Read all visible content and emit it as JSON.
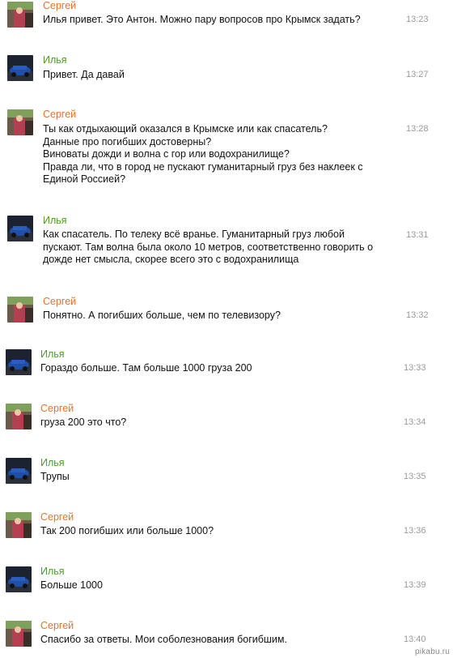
{
  "senders": {
    "sergey": "Сергей",
    "ilya": "Илья"
  },
  "colors": {
    "sergey_name": "#e8722e",
    "ilya_name": "#49a020",
    "timestamp": "#9a9a9a"
  },
  "messages": [
    {
      "sender": "Сергей",
      "time": "13:23",
      "text": "Илья привет. Это Антон. Можно пару вопросов про Крымск задать?"
    },
    {
      "sender": "Илья",
      "time": "13:27",
      "text": "Привет. Да давай"
    },
    {
      "sender": "Сергей",
      "time": "13:28",
      "text": "Ты как отдыхающий оказался в Крымске или как спасатель?\nДанные про погибших достоверны?\nВиноваты дожди и волна с гор или водохранилище?\nПравда ли, что в город не пускают гуманитарный груз без наклеек с\nЕдиной Россией?"
    },
    {
      "sender": "Илья",
      "time": "13:31",
      "text": "Как спасатель. По телеку всё вранье. Гуманитарный груз любой\nпускают. Там волна была около 10 метров, соответственно говорить о\nдожде нет смысла, скорее всего это с водохранилища"
    },
    {
      "sender": "Сергей",
      "time": "13:32",
      "text": "Понятно. А погибших больше, чем по телевизору?"
    },
    {
      "sender": "Илья",
      "time": "13:33",
      "text": "Гораздо больше. Там больше 1000 груза 200"
    },
    {
      "sender": "Сергей",
      "time": "13:34",
      "text": "груза 200 это что?"
    },
    {
      "sender": "Илья",
      "time": "13:35",
      "text": "Трупы"
    },
    {
      "sender": "Сергей",
      "time": "13:36",
      "text": "Так 200 погибших или больше 1000?"
    },
    {
      "sender": "Илья",
      "time": "13:39",
      "text": "Больше 1000"
    },
    {
      "sender": "Сергей",
      "time": "13:40",
      "text": "Спасибо за ответы. Мои соболезнования богибшим."
    }
  ],
  "watermark": "pikabu.ru"
}
